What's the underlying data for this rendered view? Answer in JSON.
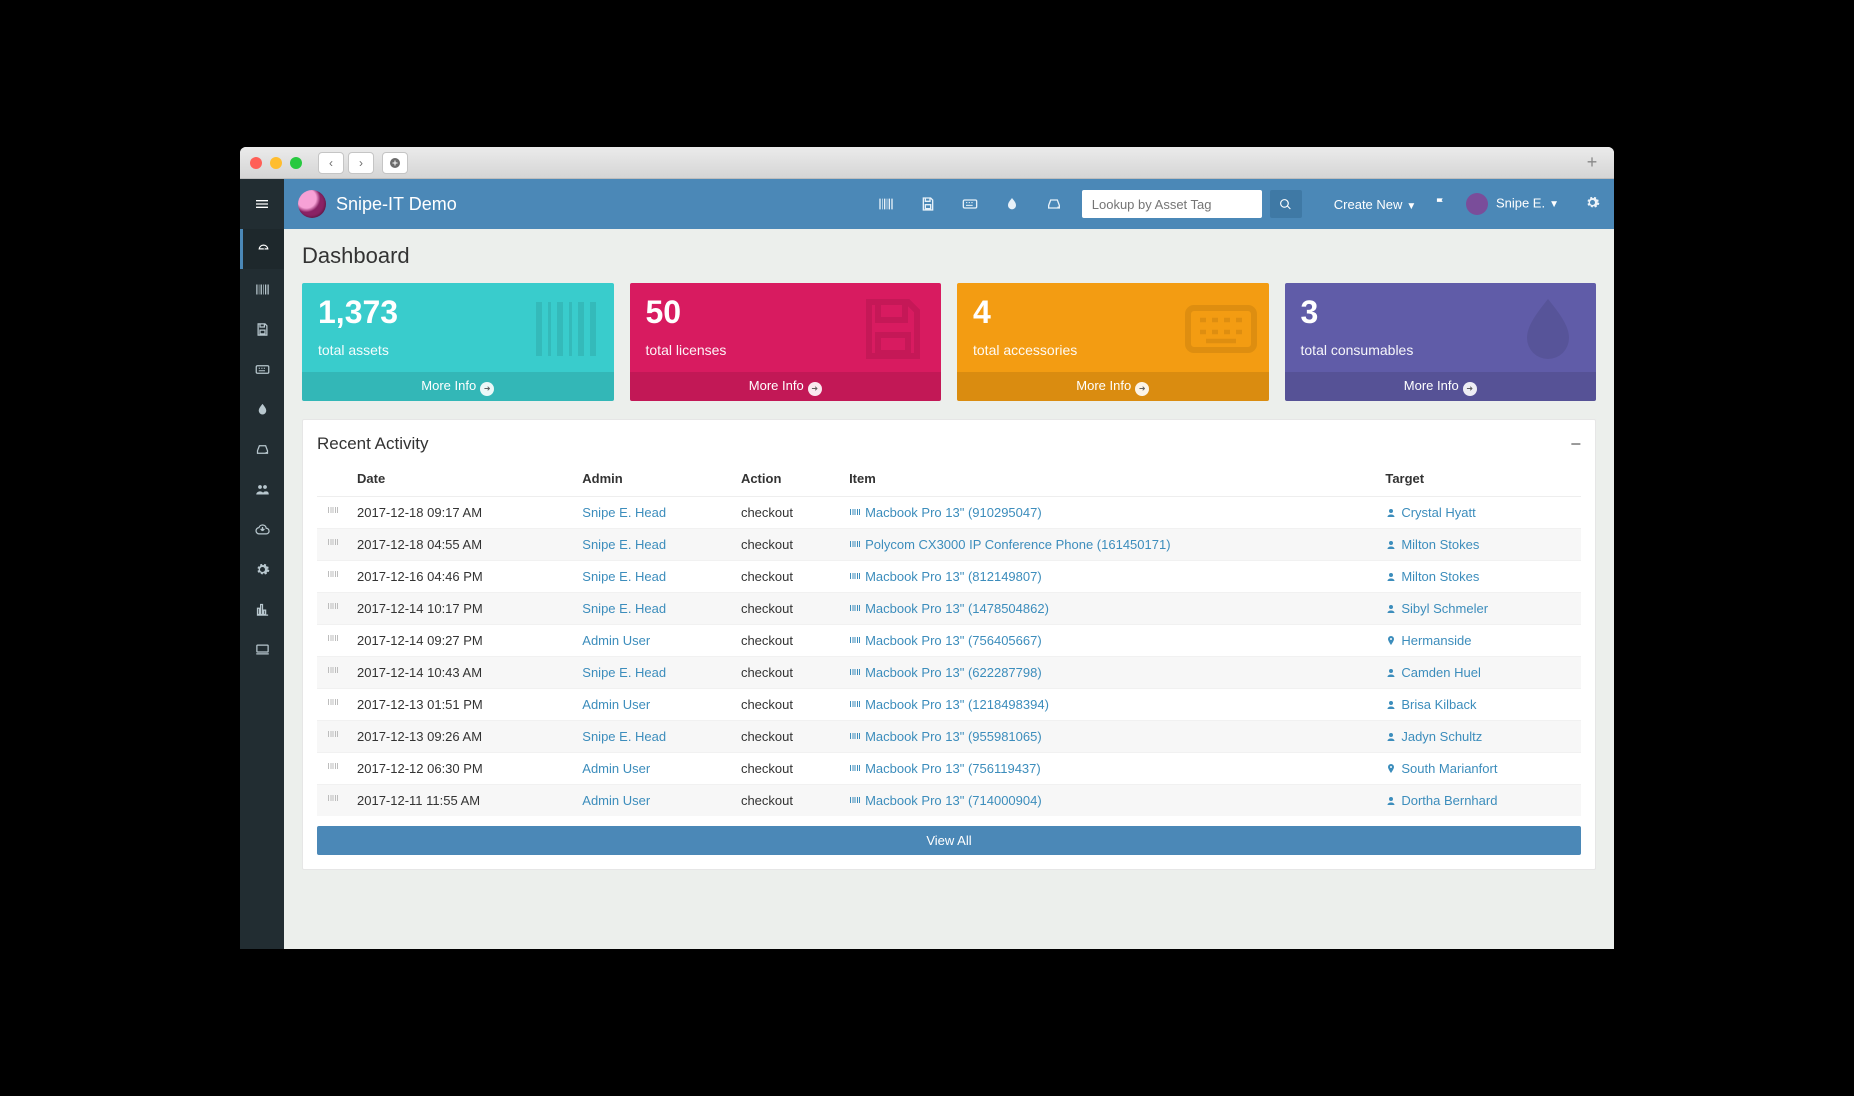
{
  "app_title": "Snipe-IT Demo",
  "search": {
    "placeholder": "Lookup by Asset Tag"
  },
  "top": {
    "create_new": "Create New",
    "user_name": "Snipe E."
  },
  "page": {
    "title": "Dashboard"
  },
  "stats": [
    {
      "count": "1,373",
      "label": "total assets",
      "more": "More Info"
    },
    {
      "count": "50",
      "label": "total licenses",
      "more": "More Info"
    },
    {
      "count": "4",
      "label": "total accessories",
      "more": "More Info"
    },
    {
      "count": "3",
      "label": "total consumables",
      "more": "More Info"
    }
  ],
  "activity": {
    "title": "Recent Activity",
    "headers": {
      "date": "Date",
      "admin": "Admin",
      "action": "Action",
      "item": "Item",
      "target": "Target"
    },
    "view_all": "View All",
    "rows": [
      {
        "date": "2017-12-18 09:17 AM",
        "admin": "Snipe E. Head",
        "action": "checkout",
        "item": "Macbook Pro 13\" (910295047)",
        "target": "Crystal Hyatt",
        "target_icon": "user"
      },
      {
        "date": "2017-12-18 04:55 AM",
        "admin": "Snipe E. Head",
        "action": "checkout",
        "item": "Polycom CX3000 IP Conference Phone (161450171)",
        "target": "Milton Stokes",
        "target_icon": "user"
      },
      {
        "date": "2017-12-16 04:46 PM",
        "admin": "Snipe E. Head",
        "action": "checkout",
        "item": "Macbook Pro 13\" (812149807)",
        "target": "Milton Stokes",
        "target_icon": "user"
      },
      {
        "date": "2017-12-14 10:17 PM",
        "admin": "Snipe E. Head",
        "action": "checkout",
        "item": "Macbook Pro 13\" (1478504862)",
        "target": "Sibyl Schmeler",
        "target_icon": "user"
      },
      {
        "date": "2017-12-14 09:27 PM",
        "admin": "Admin User",
        "action": "checkout",
        "item": "Macbook Pro 13\" (756405667)",
        "target": "Hermanside",
        "target_icon": "location"
      },
      {
        "date": "2017-12-14 10:43 AM",
        "admin": "Snipe E. Head",
        "action": "checkout",
        "item": "Macbook Pro 13\" (622287798)",
        "target": "Camden Huel",
        "target_icon": "user"
      },
      {
        "date": "2017-12-13 01:51 PM",
        "admin": "Admin User",
        "action": "checkout",
        "item": "Macbook Pro 13\" (1218498394)",
        "target": "Brisa Kilback",
        "target_icon": "user"
      },
      {
        "date": "2017-12-13 09:26 AM",
        "admin": "Snipe E. Head",
        "action": "checkout",
        "item": "Macbook Pro 13\" (955981065)",
        "target": "Jadyn Schultz",
        "target_icon": "user"
      },
      {
        "date": "2017-12-12 06:30 PM",
        "admin": "Admin User",
        "action": "checkout",
        "item": "Macbook Pro 13\" (756119437)",
        "target": "South Marianfort",
        "target_icon": "location"
      },
      {
        "date": "2017-12-11 11:55 AM",
        "admin": "Admin User",
        "action": "checkout",
        "item": "Macbook Pro 13\" (714000904)",
        "target": "Dortha Bernhard",
        "target_icon": "user"
      }
    ]
  }
}
